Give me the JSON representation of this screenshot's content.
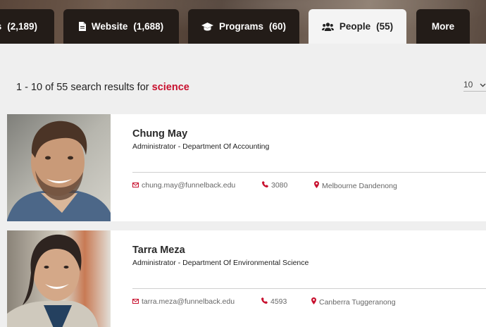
{
  "tabs": [
    {
      "key": "events",
      "label": "ts",
      "count": "(2,189)",
      "icon": "calendar-icon"
    },
    {
      "key": "website",
      "label": "Website",
      "count": "(1,688)",
      "icon": "document-icon"
    },
    {
      "key": "programs",
      "label": "Programs",
      "count": "(60)",
      "icon": "graduation-cap-icon"
    },
    {
      "key": "people",
      "label": "People",
      "count": "(55)",
      "icon": "users-icon",
      "active": true
    },
    {
      "key": "more",
      "label": "More"
    }
  ],
  "summary": {
    "range": "1 - 10 of 55 search results for",
    "query": "science"
  },
  "per_page": {
    "value": "10"
  },
  "people": [
    {
      "name": "Chung May",
      "role": "Administrator - Department Of Accounting",
      "email": "chung.may@funnelback.edu",
      "phone": "3080",
      "location": "Melbourne Dandenong"
    },
    {
      "name": "Tarra Meza",
      "role": "Administrator - Department Of Environmental Science",
      "email": "tarra.meza@funnelback.edu",
      "phone": "4593",
      "location": "Canberra Tuggeranong"
    }
  ],
  "colors": {
    "accent": "#c8102e",
    "tab_dark": "#231c18",
    "tab_active": "#f4f4f4"
  }
}
